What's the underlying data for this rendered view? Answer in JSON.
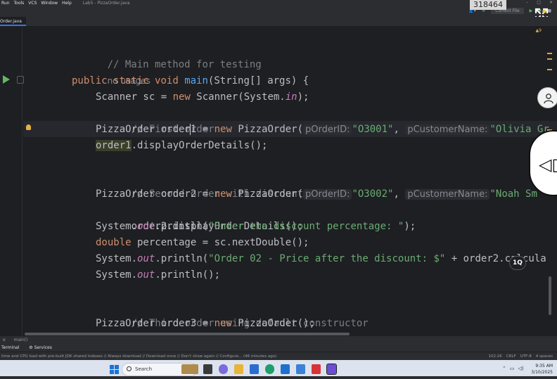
{
  "menubar": {
    "items": [
      "Run",
      "Tools",
      "VCS",
      "Window",
      "Help"
    ],
    "title": "Lab5 - PizzaOrder.java"
  },
  "toolbar": {
    "run_config": "Current File",
    "counter": "318464"
  },
  "tabs": [
    {
      "label": "Order.java"
    }
  ],
  "editor": {
    "warning_count": "▲9",
    "lines": {
      "c1": "// Main method for testing",
      "usage": "no usages",
      "l3": {
        "kw1": "public",
        "kw2": "static",
        "kw3": "void",
        "fn": "main",
        "rest": "(String[] args) {"
      },
      "l4": {
        "a": "Scanner sc = ",
        "kw": "new",
        "b": " Scanner(System.",
        "it": "in",
        "c": ");"
      },
      "c2": "// First order",
      "l6": {
        "a": "PizzaOrder order",
        "b": "1",
        "c": " = ",
        "kw": "new",
        "d": " PizzaOrder(",
        "h1": "pOrderID:",
        "s1": "\"O3001\"",
        "sep": ", ",
        "h2": "pCustomerName:",
        "s2": "\"Olivia Gr"
      },
      "l7": {
        "a": "order1",
        "b": ".displayOrderDetails();"
      },
      "c3": "// Second order with discount",
      "l10": {
        "a": "PizzaOrder order2 = ",
        "kw": "new",
        "d": " PizzaOrder(",
        "h1": "pOrderID:",
        "s1": "\"O3002\"",
        "sep": ", ",
        "h2": "pCustomerName:",
        "s2": "\"Noah Sm"
      },
      "l11": "order2.displayOrderDetails();",
      "l12": {
        "a": "System.",
        "it": "out",
        "b": ".println(",
        "s": "\"Enter the discount percentage: \"",
        "c": ");"
      },
      "l13": {
        "kw": "double",
        "a": " percentage = sc.nextDouble();"
      },
      "l14": {
        "a": "System.",
        "it": "out",
        "b": ".println(",
        "s": "\"Order 02 - Price after the discount: $\"",
        "c": " + order2.calcula"
      },
      "l15": {
        "a": "System.",
        "it": "out",
        "b": ".println();"
      },
      "c4": "// Third order using default constructor",
      "l18": {
        "a": "PizzaOrder order3 = ",
        "kw": "new",
        "b": " PizzaOrder();"
      }
    }
  },
  "overlay": {
    "float_badge": "1Q"
  },
  "breadcrumb": [
    "e",
    "main()"
  ],
  "toolwindows": [
    "Terminal",
    "Services"
  ],
  "status": {
    "message": "time and CPU load with pre-built JDK shared indexes // Always download // Download once // Don't show again // Configure... (46 minutes ago)",
    "position": "102:26",
    "line_sep": "CRLF",
    "encoding": "UTF-8",
    "indent": "4 spaces"
  },
  "taskbar": {
    "search_placeholder": "Search",
    "time": "9:35 AM",
    "date": "3/10/2025"
  },
  "colors": {
    "editor_bg": "#1e1f22",
    "keyword": "#cf8e6d",
    "string": "#6aab73",
    "comment": "#7a7e85",
    "function": "#56a8f5",
    "static_field": "#c77dbb"
  }
}
